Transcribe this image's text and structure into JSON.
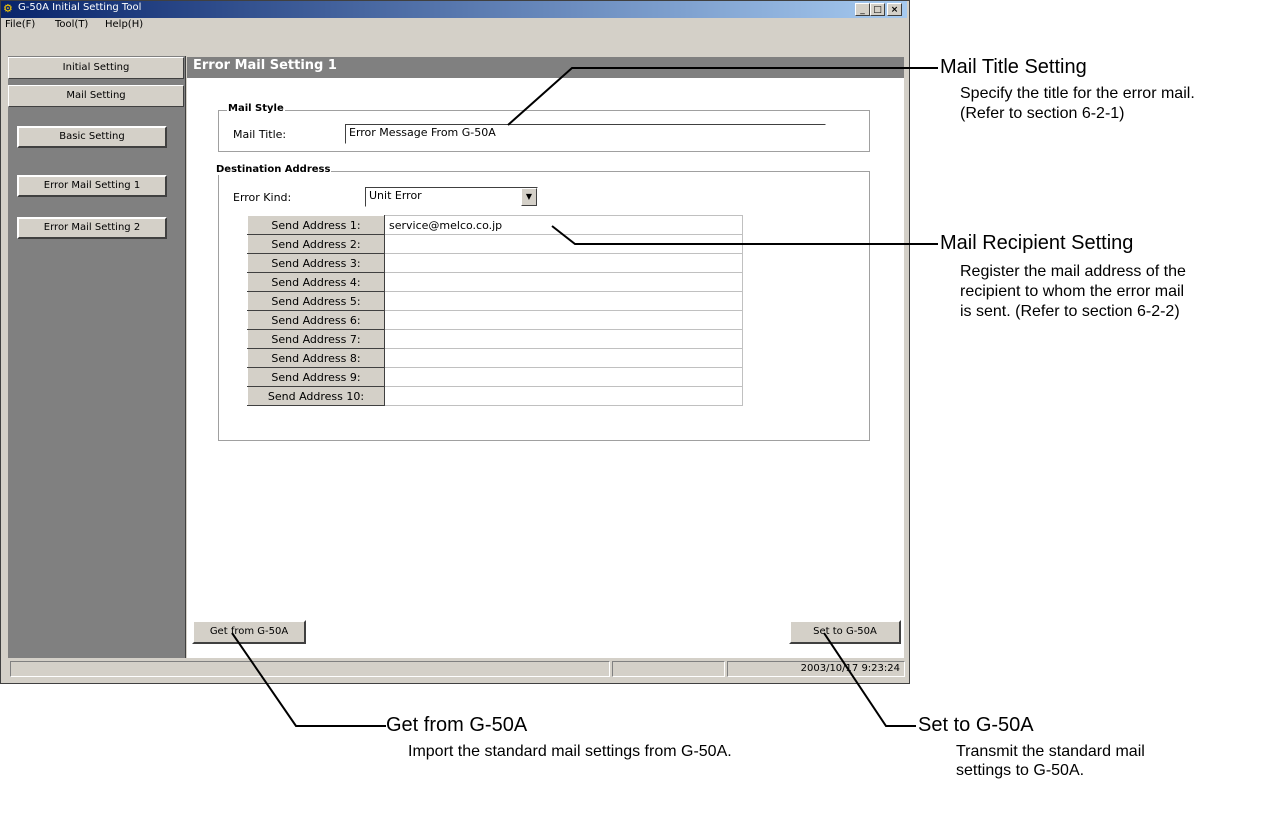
{
  "window": {
    "title": "G-50A Initial Setting Tool",
    "menu": [
      "File(F)",
      "Tool(T)",
      "Help(H)"
    ],
    "minimize_glyph": "_",
    "maximize_glyph": "□",
    "close_glyph": "×"
  },
  "sidebar": {
    "tab_initial": "Initial Setting",
    "tab_mail": "Mail Setting",
    "buttons": [
      "Basic Setting",
      "Error Mail Setting 1",
      "Error Mail Setting 2"
    ]
  },
  "main": {
    "title": "Error Mail Setting 1",
    "mail_style": {
      "group_title": "Mail Style",
      "label": "Mail Title:",
      "value": "Error Message From G-50A"
    },
    "destination": {
      "group_title": "Destination Address",
      "error_kind_label": "Error Kind:",
      "error_kind_value": "Unit Error",
      "addresses": [
        {
          "label": "Send Address 1:",
          "value": "service@melco.co.jp"
        },
        {
          "label": "Send Address 2:",
          "value": ""
        },
        {
          "label": "Send Address 3:",
          "value": ""
        },
        {
          "label": "Send Address 4:",
          "value": ""
        },
        {
          "label": "Send Address 5:",
          "value": ""
        },
        {
          "label": "Send Address 6:",
          "value": ""
        },
        {
          "label": "Send Address 7:",
          "value": ""
        },
        {
          "label": "Send Address 8:",
          "value": ""
        },
        {
          "label": "Send Address 9:",
          "value": ""
        },
        {
          "label": "Send Address 10:",
          "value": ""
        }
      ]
    },
    "get_button": "Get from G-50A",
    "set_button": "Set to G-50A"
  },
  "status": {
    "timestamp": "2003/10/17 9:23:24"
  },
  "annotations": {
    "mail_title": {
      "title": "Mail Title Setting",
      "lines": [
        "Specify the title for the error mail.",
        "(Refer to section 6-2-1)"
      ]
    },
    "mail_recipient": {
      "title": "Mail Recipient Setting",
      "lines": [
        "Register the mail address of the",
        "recipient to whom the error mail",
        "is sent.  (Refer to section 6-2-2)"
      ]
    },
    "get_from": {
      "title": "Get from G-50A",
      "lines": [
        "Import the standard mail settings from G-50A."
      ]
    },
    "set_to": {
      "title": "Set to G-50A",
      "lines": [
        "Transmit the standard mail",
        "settings to G-50A."
      ]
    }
  },
  "colors": {
    "titlebar_start": "#08246b",
    "titlebar_end": "#a6caf0",
    "window_face": "#d4d0c8",
    "sidebar_bg": "#808080",
    "header_bg": "#808080"
  }
}
